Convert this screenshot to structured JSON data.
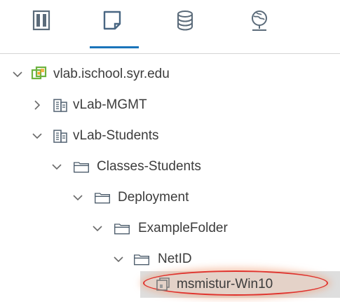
{
  "tabs": [
    {
      "icon": "hosts-clusters-icon",
      "active": false
    },
    {
      "icon": "vms-templates-icon",
      "active": true
    },
    {
      "icon": "storage-icon",
      "active": false
    },
    {
      "icon": "networking-icon",
      "active": false
    }
  ],
  "tree": {
    "root": {
      "label": "vlab.ischool.syr.edu",
      "icon": "vcenter-icon",
      "expanded": true
    },
    "datacenter_mgmt": {
      "label": "vLab-MGMT",
      "icon": "datacenter-icon",
      "expanded": false
    },
    "datacenter_students": {
      "label": "vLab-Students",
      "icon": "datacenter-icon",
      "expanded": true
    },
    "folder_classes": {
      "label": "Classes-Students",
      "icon": "folder-icon",
      "expanded": true
    },
    "folder_deployment": {
      "label": "Deployment",
      "icon": "folder-icon",
      "expanded": true
    },
    "folder_example": {
      "label": "ExampleFolder",
      "icon": "folder-icon",
      "expanded": true
    },
    "folder_netid": {
      "label": "NetID",
      "icon": "folder-icon",
      "expanded": true
    },
    "vm": {
      "label": "msmistur-Win10",
      "icon": "vm-icon",
      "selected": true
    }
  },
  "colors": {
    "accent": "#1a74ba",
    "highlight": "#e0322c",
    "vcenter_green": "#6db33f",
    "vcenter_orange": "#f3a72b"
  }
}
